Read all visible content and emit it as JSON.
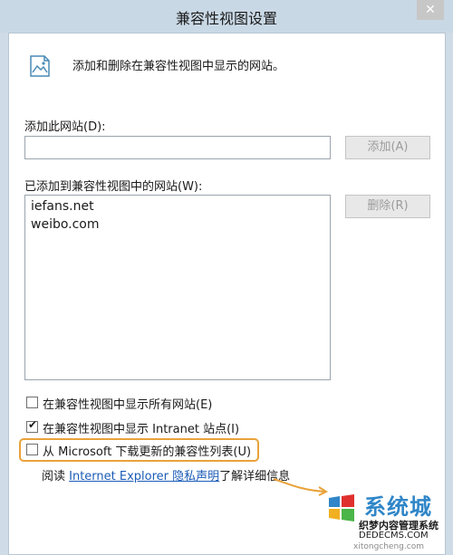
{
  "window": {
    "title": "兼容性视图设置",
    "close_label": "✕"
  },
  "header": {
    "text": "添加和删除在兼容性视图中显示的网站。"
  },
  "add_site": {
    "label": "添加此网站(D):",
    "value": "",
    "placeholder": "",
    "button_label": "添加(A)"
  },
  "added_sites": {
    "label": "已添加到兼容性视图中的网站(W):",
    "items": [
      "iefans.net",
      "weibo.com"
    ],
    "remove_button_label": "删除(R)"
  },
  "options": [
    {
      "label": "在兼容性视图中显示所有网站(E)",
      "checked": false
    },
    {
      "label": "在兼容性视图中显示 Intranet 站点(I)",
      "checked": true
    },
    {
      "label": "从 Microsoft 下载更新的兼容性列表(U)",
      "checked": false
    }
  ],
  "privacy": {
    "prefix": "阅读 ",
    "link_text": "Internet Explorer 隐私声明",
    "suffix": "了解详细信息"
  },
  "watermark": {
    "brand": "系统城",
    "line1": "织梦内容管理系统",
    "line2": "DEDECMS.COM",
    "line3": "xitongcheng.com"
  },
  "colors": {
    "accent": "#e8a23a",
    "link": "#1a5bb7"
  }
}
